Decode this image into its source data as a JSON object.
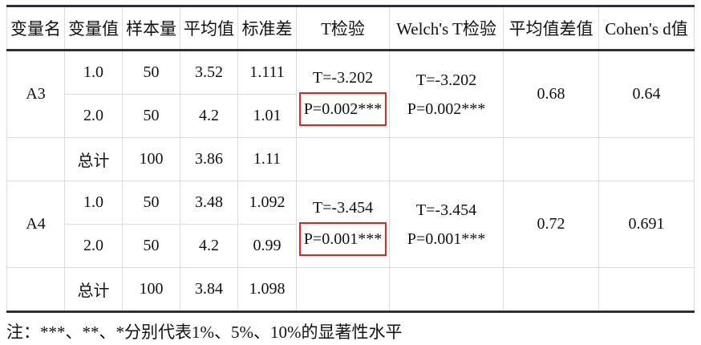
{
  "headers": [
    "变量名",
    "变量值",
    "样本量",
    "平均值",
    "标准差",
    "T检验",
    "Welch's T检验",
    "平均值差值",
    "Cohen's d值"
  ],
  "groups": [
    {
      "name": "A3",
      "rows": [
        {
          "value": "1.0",
          "n": "50",
          "mean": "3.52",
          "sd": "1.111"
        },
        {
          "value": "2.0",
          "n": "50",
          "mean": "4.2",
          "sd": "1.01"
        }
      ],
      "t_test": {
        "t": "T=-3.202",
        "p": "P=0.002***"
      },
      "welch": {
        "t": "T=-3.202",
        "p": "P=0.002***"
      },
      "mean_diff": "0.68",
      "cohens_d": "0.64",
      "total": {
        "label": "总计",
        "n": "100",
        "mean": "3.86",
        "sd": "1.11"
      }
    },
    {
      "name": "A4",
      "rows": [
        {
          "value": "1.0",
          "n": "50",
          "mean": "3.48",
          "sd": "1.092"
        },
        {
          "value": "2.0",
          "n": "50",
          "mean": "4.2",
          "sd": "0.99"
        }
      ],
      "t_test": {
        "t": "T=-3.454",
        "p": "P=0.001***"
      },
      "welch": {
        "t": "T=-3.454",
        "p": "P=0.001***"
      },
      "mean_diff": "0.72",
      "cohens_d": "0.691",
      "total": {
        "label": "总计",
        "n": "100",
        "mean": "3.84",
        "sd": "1.098"
      }
    }
  ],
  "highlight_color": "#e0261c",
  "note": "注：***、**、*分别代表1%、5%、10%的显著性水平"
}
